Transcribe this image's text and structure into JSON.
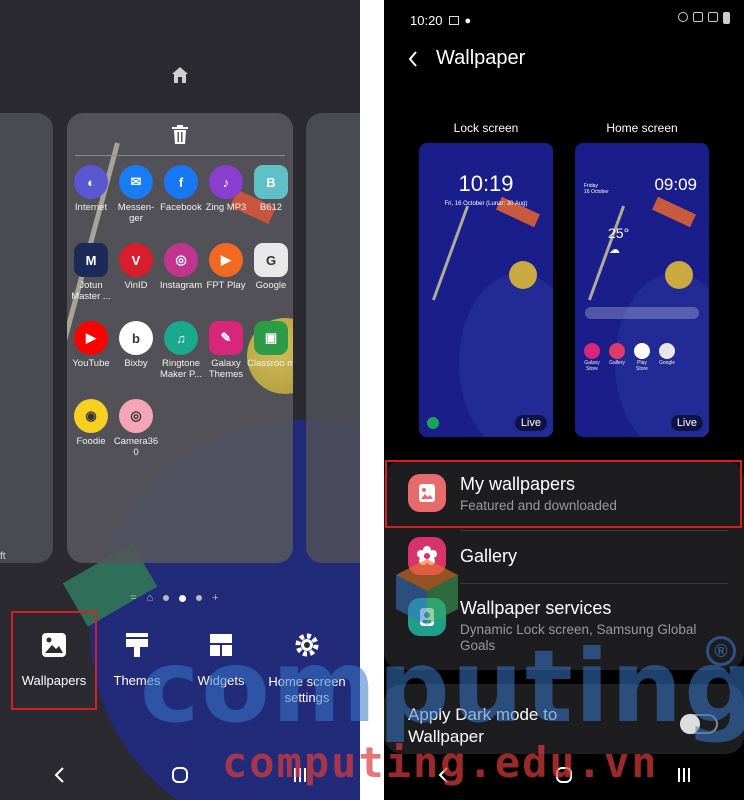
{
  "left_screen": {
    "side_card_text": "ft",
    "apps": [
      {
        "label": "Internet",
        "icon": "internet-icon",
        "color": "#5a58d0",
        "glyph": "◐"
      },
      {
        "label": "Messen-ger",
        "icon": "messenger-icon",
        "color": "#1a7cf2",
        "glyph": "✉"
      },
      {
        "label": "Facebook",
        "icon": "facebook-icon",
        "color": "#1877f2",
        "glyph": "f"
      },
      {
        "label": "Zing MP3",
        "icon": "zing-mp3-icon",
        "color": "#8a3fd0",
        "glyph": "♪"
      },
      {
        "label": "B612",
        "icon": "b612-icon",
        "color": "#5fc0c8",
        "glyph": "B"
      },
      {
        "label": "Jotun Master ...",
        "icon": "jotun-icon",
        "color": "#1c2a5a",
        "glyph": "M"
      },
      {
        "label": "VinID",
        "icon": "vinid-icon",
        "color": "#d81e2c",
        "glyph": "V"
      },
      {
        "label": "Instagram",
        "icon": "instagram-icon",
        "color": "#c2358f",
        "glyph": "◎"
      },
      {
        "label": "FPT Play",
        "icon": "fpt-play-icon",
        "color": "#f26a22",
        "glyph": "▶"
      },
      {
        "label": "Google",
        "icon": "google-icon",
        "color": "#e8e8e8",
        "glyph": "G"
      },
      {
        "label": "YouTube",
        "icon": "youtube-icon",
        "color": "#ff0000",
        "glyph": "▶"
      },
      {
        "label": "Bixby",
        "icon": "bixby-icon",
        "color": "#ffffff",
        "glyph": "b"
      },
      {
        "label": "Ringtone Maker P...",
        "icon": "ringtone-maker-icon",
        "color": "#1aa88e",
        "glyph": "♫"
      },
      {
        "label": "Galaxy Themes",
        "icon": "galaxy-themes-icon",
        "color": "#d8267a",
        "glyph": "✎"
      },
      {
        "label": "Classroo m",
        "icon": "classroom-icon",
        "color": "#2e9b48",
        "glyph": "▣"
      },
      {
        "label": "Foodie",
        "icon": "foodie-icon",
        "color": "#f5d020",
        "glyph": "◉"
      },
      {
        "label": "Camera36 0",
        "icon": "camera360-icon",
        "color": "#f4a6b8",
        "glyph": "◎"
      }
    ],
    "toolbar": [
      {
        "label": "Wallpapers",
        "icon": "wallpaper-icon"
      },
      {
        "label": "Themes",
        "icon": "themes-icon"
      },
      {
        "label": "Widgets",
        "icon": "widgets-icon"
      },
      {
        "label": "Home screen settings",
        "icon": "gear-icon"
      }
    ]
  },
  "right_screen": {
    "status": {
      "time": "10:20"
    },
    "header": {
      "title": "Wallpaper"
    },
    "previews": {
      "lock_label": "Lock screen",
      "home_label": "Home screen",
      "lock_time": "10:19",
      "lock_date": "Fri, 16 October (Lunar: 30 Aug)",
      "home_time": "09:09",
      "home_day": "Friday",
      "home_date": "16 October",
      "home_temp": "25°",
      "live_label": "Live",
      "home_apps": [
        {
          "label": "Galaxy Store",
          "color": "#d8267a"
        },
        {
          "label": "Gallery",
          "color": "#e03a6a"
        },
        {
          "label": "Play Store",
          "color": "#ffffff"
        },
        {
          "label": "Google",
          "color": "#e8e8e8"
        }
      ],
      "dock_colors": [
        "#1aa35a",
        "#3070f0",
        "#e03030",
        "#1a7cf2",
        "#e0245a"
      ]
    },
    "menu": {
      "my_wallpapers_title": "My wallpapers",
      "my_wallpapers_sub": "Featured and downloaded",
      "gallery_title": "Gallery",
      "services_title": "Wallpaper services",
      "services_sub": "Dynamic Lock screen, Samsung Global Goals"
    },
    "dark_mode": {
      "label": "Apply Dark mode to Wallpaper"
    }
  },
  "watermark": {
    "big": "computing",
    "url": "computing.edu.vn",
    "reg": "®"
  },
  "colors": {
    "highlight": "#d42020",
    "accent_blue": "#3876c8",
    "wm_red": "#dc3c3c"
  }
}
